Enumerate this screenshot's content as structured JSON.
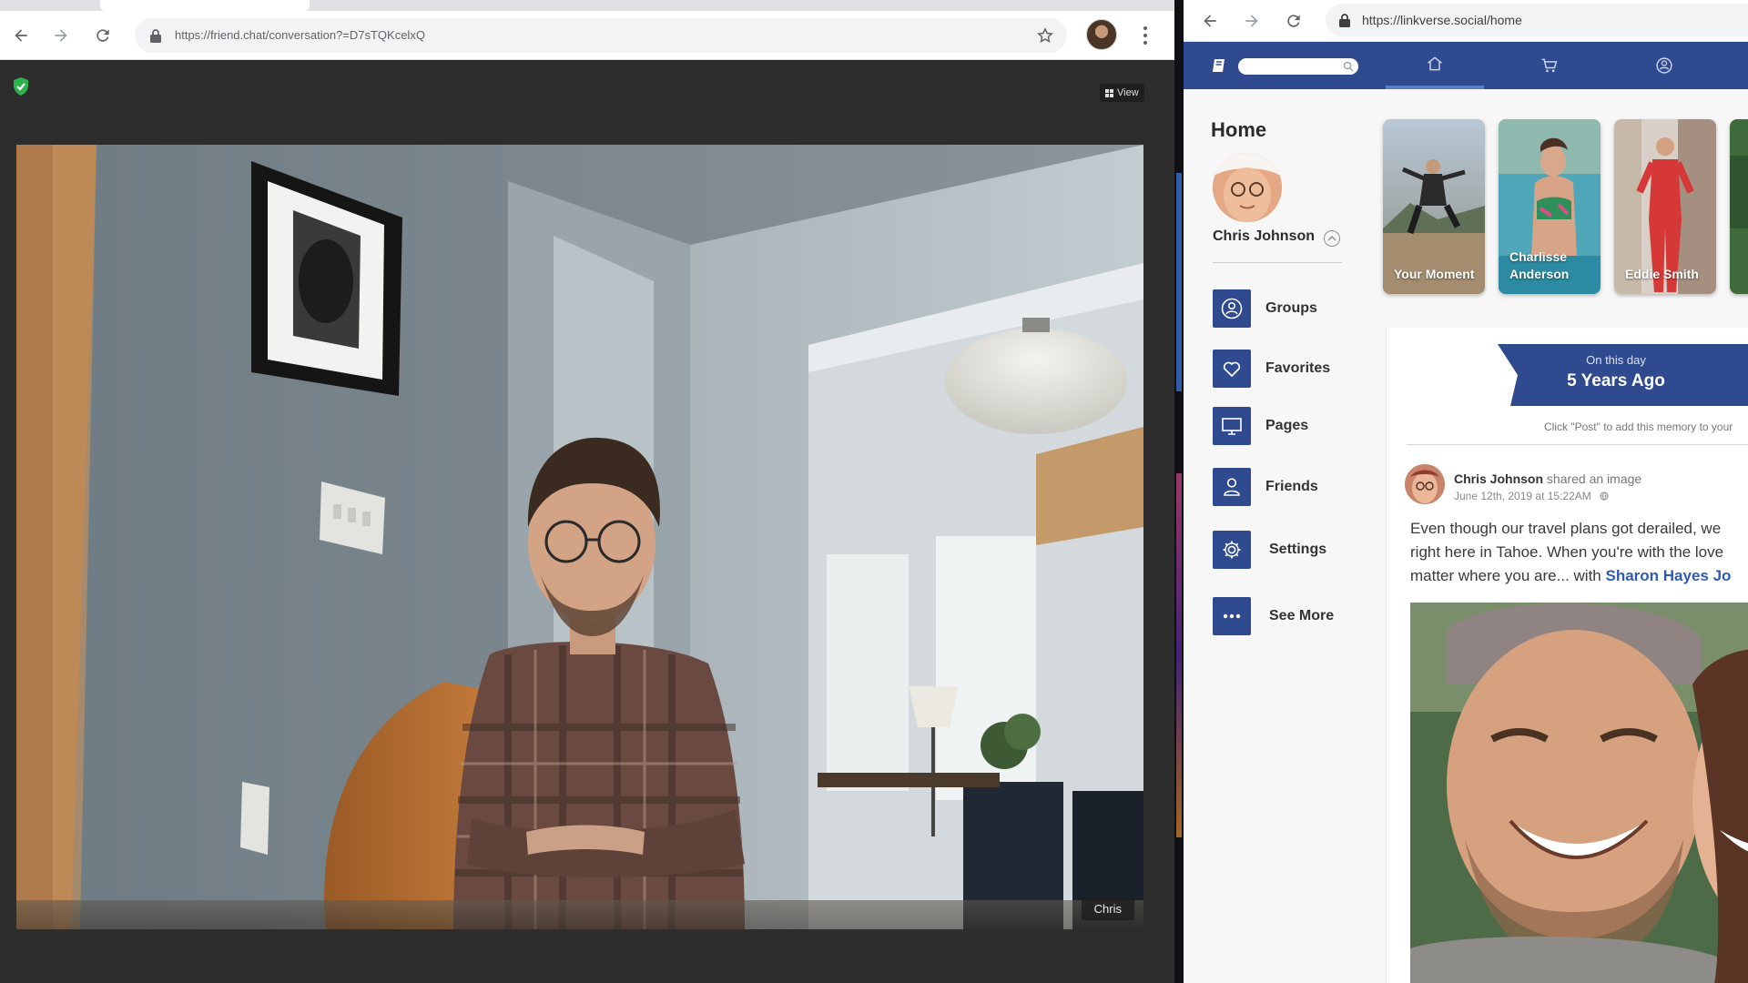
{
  "left_browser": {
    "url": "https://friend.chat/conversation?=D7sTQKcelxQ",
    "view_button_label": "View",
    "participant_name": "Chris"
  },
  "right_browser": {
    "url": "https://linkverse.social/home",
    "home_title": "Home",
    "profile_name": "Chris Johnson",
    "menu_items": [
      {
        "label": "Groups",
        "icon": "groups-icon"
      },
      {
        "label": "Favorites",
        "icon": "heart-icon"
      },
      {
        "label": "Pages",
        "icon": "monitor-icon"
      },
      {
        "label": "Friends",
        "icon": "person-icon"
      },
      {
        "label": "Settings",
        "icon": "gear-icon"
      },
      {
        "label": "See More",
        "icon": "more-icon"
      }
    ],
    "stories": [
      {
        "label": "Your Moment"
      },
      {
        "label": "Charlisse Anderson"
      },
      {
        "label": "Eddie Smith"
      }
    ],
    "memory": {
      "on_this_day": "On this day",
      "years_ago": "5 Years Ago",
      "hint": "Click \"Post\" to add this memory to your"
    },
    "post": {
      "author": "Chris Johnson",
      "action": "shared an image",
      "date": "June 12th, 2019 at 15:22AM",
      "text_line1": "Even though our travel plans got derailed, we",
      "text_line2": "right here in Tahoe. When you're with the love",
      "text_line3": "matter where you are... with ",
      "mention": "Sharon Hayes Jo"
    }
  },
  "colors": {
    "brand_blue": "#2f4a8f",
    "link_blue": "#2f5bb4",
    "call_background": "#2d2d2d",
    "shield_green": "#2fb14d"
  }
}
